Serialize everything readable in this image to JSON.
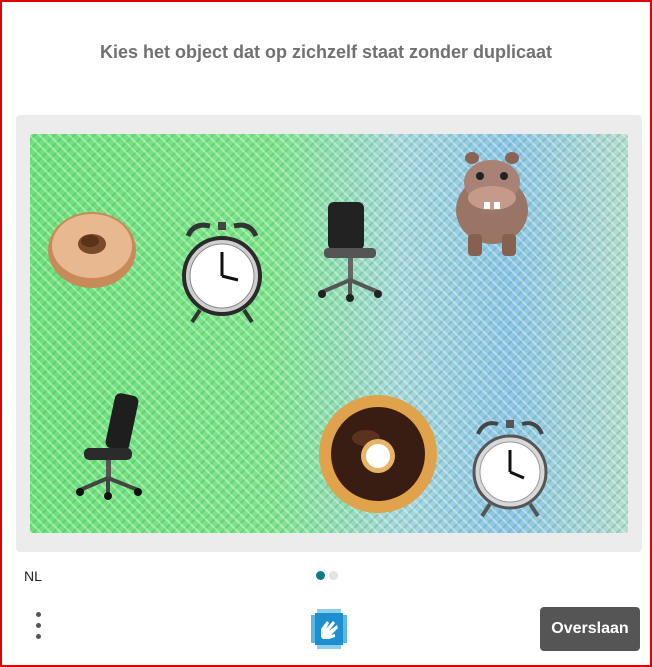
{
  "prompt": {
    "text": "Kies het object dat op zichzelf staat zonder duplicaat"
  },
  "language": {
    "label": "NL"
  },
  "pagination": {
    "pages": 2,
    "current": 1
  },
  "actions": {
    "skip_label": "Overslaan"
  },
  "objects": [
    {
      "name": "donut-plain",
      "icon": "donut-icon"
    },
    {
      "name": "alarm-clock-1",
      "icon": "alarm-clock-icon"
    },
    {
      "name": "office-chair-1",
      "icon": "office-chair-icon"
    },
    {
      "name": "hippo",
      "icon": "hippo-icon"
    },
    {
      "name": "office-chair-2",
      "icon": "office-chair-icon"
    },
    {
      "name": "donut-chocolate",
      "icon": "donut-icon"
    },
    {
      "name": "alarm-clock-2",
      "icon": "alarm-clock-icon"
    }
  ],
  "colors": {
    "frame_border": "#e00000",
    "prompt_text": "#707070",
    "panel_bg": "#ececec",
    "button_bg": "#555555",
    "dot_active": "#0a7b8c",
    "dot_inactive": "#e3e3e3",
    "logo_blue": "#2fa6e0"
  }
}
